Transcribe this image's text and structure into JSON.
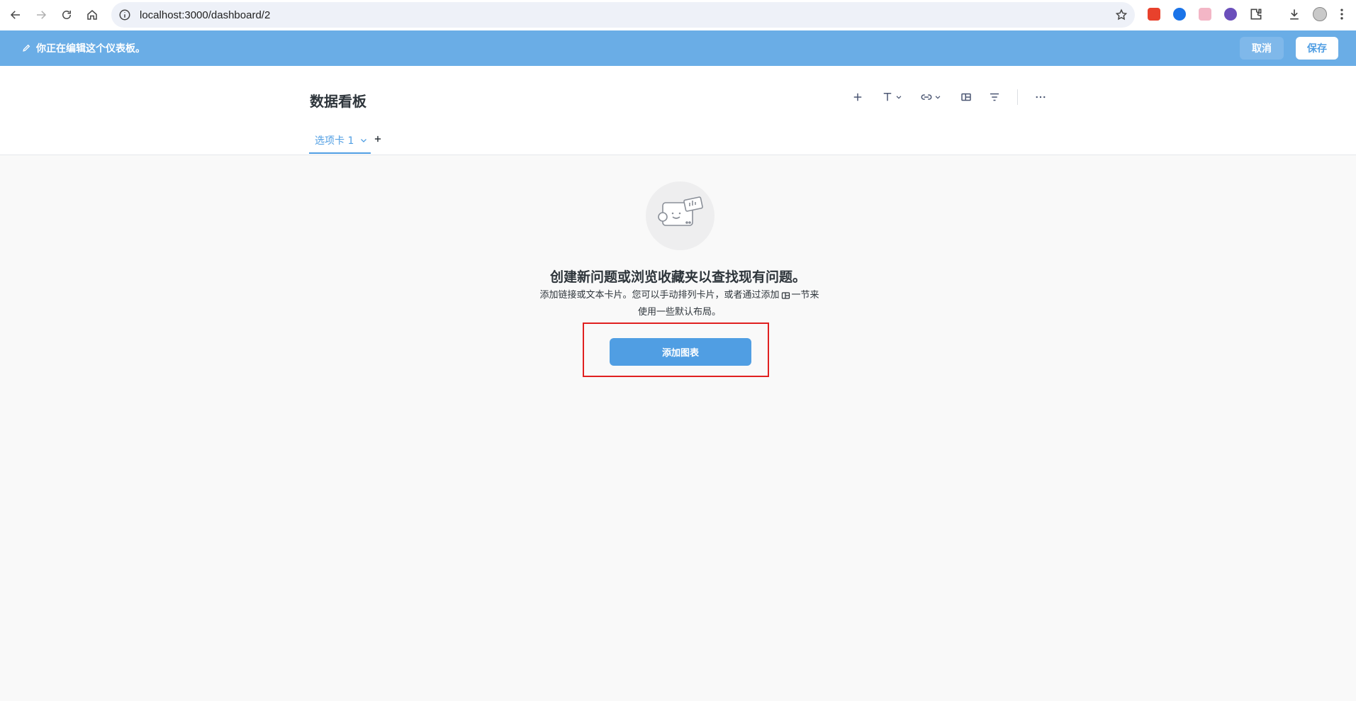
{
  "browser": {
    "url": "localhost:3000/dashboard/2",
    "extension_colors": [
      "#e8412c",
      "#1a73e8",
      "#f3b6c6",
      "#6b4fbb"
    ]
  },
  "edit_bar": {
    "message": "你正在编辑这个仪表板。",
    "cancel_label": "取消",
    "save_label": "保存"
  },
  "dashboard": {
    "title": "数据看板",
    "tabs": [
      {
        "label": "选项卡 1"
      }
    ],
    "toolbar_icons": [
      "plus-icon",
      "text-icon",
      "link-icon",
      "section-icon",
      "filter-icon",
      "more-icon"
    ]
  },
  "empty_state": {
    "title": "创建新问题或浏览收藏夹以查找现有问题。",
    "description_before": "添加链接或文本卡片。您可以手动排列卡片，或者通过添加",
    "description_after": "一节来使用一些默认布局。",
    "add_button_label": "添加图表"
  },
  "colors": {
    "brand": "#509ee3",
    "edit_bar": "#6aade6",
    "highlight": "#e02020"
  }
}
